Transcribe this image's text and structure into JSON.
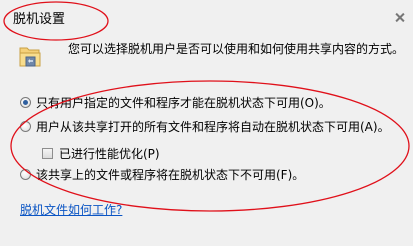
{
  "window": {
    "title": "脱机设置"
  },
  "main": {
    "intro": "您可以选择脱机用户是否可以使用和如何使用共享内容的方式。",
    "options": [
      {
        "label": "只有用户指定的文件和程序才能在脱机状态下可用(O)。",
        "type": "radio",
        "checked": true
      },
      {
        "label": "用户从该共享打开的所有文件和程序将自动在脱机状态下可用(A)。",
        "type": "radio",
        "checked": false
      },
      {
        "label": "已进行性能优化(P)",
        "type": "checkbox",
        "checked": false
      },
      {
        "label": "该共享上的文件或程序将在脱机状态下不可用(F)。",
        "type": "radio",
        "checked": false
      }
    ],
    "help_link": "脱机文件如何工作?"
  },
  "annotations": {
    "color": "#e0101a"
  },
  "icons": [
    "close-icon",
    "offline-folder-icon"
  ]
}
